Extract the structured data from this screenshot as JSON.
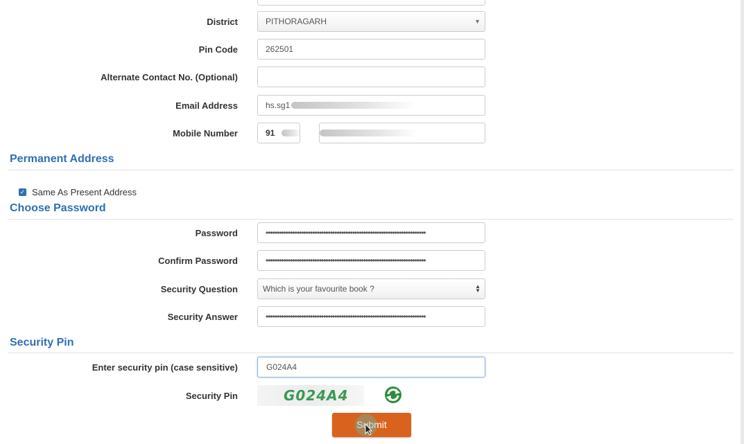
{
  "present_address": {
    "district": {
      "label": "District",
      "value": "PITHORAGARH"
    },
    "pin_code": {
      "label": "Pin Code",
      "value": "262501"
    },
    "alt_contact": {
      "label": "Alternate Contact No. (Optional)",
      "value": ""
    },
    "email": {
      "label": "Email Address",
      "value": "hs.sg1"
    },
    "mobile": {
      "label": "Mobile Number",
      "country_code": "91"
    }
  },
  "permanent_address": {
    "title": "Permanent Address",
    "same_as_present_label": "Same As Present Address",
    "same_as_present_checked": true
  },
  "choose_password": {
    "title": "Choose Password",
    "password": {
      "label": "Password",
      "value": "••••••••••••••••••••••••••••••••••••••••••••••••••••••••••••••••••••••••"
    },
    "confirm_password": {
      "label": "Confirm Password",
      "value": "••••••••••••••••••••••••••••••••••••••••••••••••••••••••••••••••••••••••"
    },
    "security_question": {
      "label": "Security Question",
      "value": "Which is your favourite book ?"
    },
    "security_answer": {
      "label": "Security Answer",
      "value": "••••••••••••••••••••••••••••••••••••••••••••••••••••••••••••••••••••••••"
    }
  },
  "security_pin": {
    "title": "Security Pin",
    "enter_label": "Enter security pin (case sensitive)",
    "enter_value": "G024A4",
    "captcha_label": "Security Pin",
    "captcha_text": "G024A4"
  },
  "submit_label": "Submit",
  "colors": {
    "section": "#2f6fb5",
    "submit": "#d9621e",
    "checkbox": "#2f6fb5"
  },
  "icons": {
    "refresh": "refresh-icon",
    "cursor": "mouse-pointer-icon"
  }
}
